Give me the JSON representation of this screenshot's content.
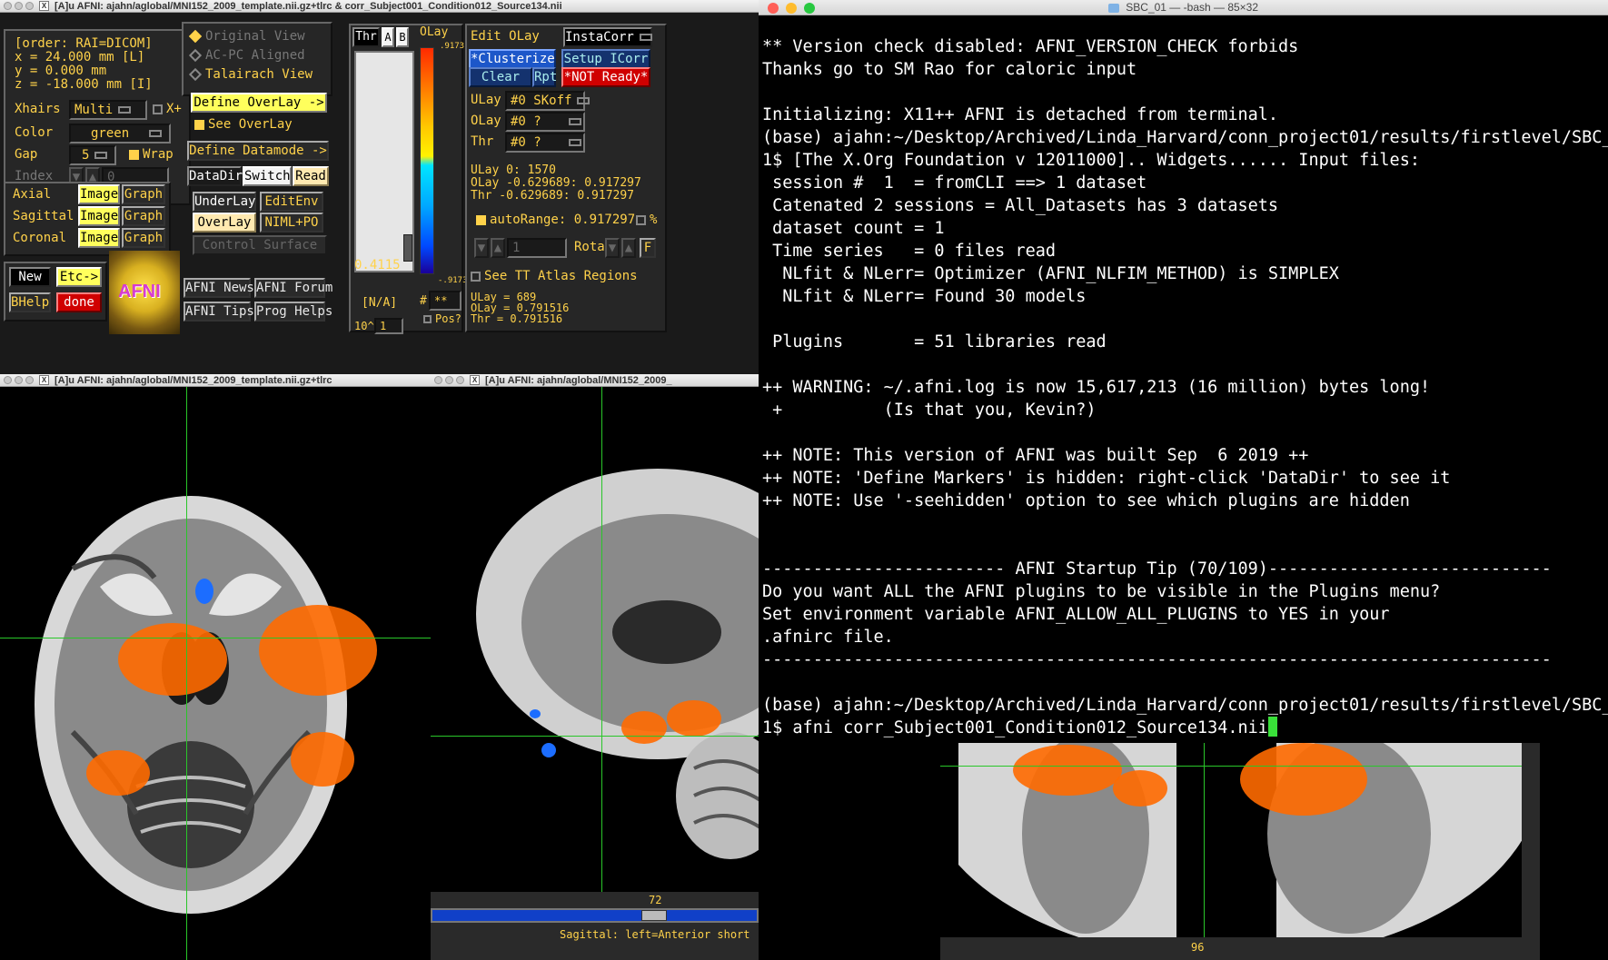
{
  "afni_title": "[A]u AFNI: ajahn/aglobal/MNI152_2009_template.nii.gz+tlrc & corr_Subject001_Condition012_Source134.nii",
  "axial_title": "[A]u AFNI: ajahn/aglobal/MNI152_2009_template.nii.gz+tlrc",
  "sagittal_title": "[A]u AFNI: ajahn/aglobal/MNI152_2009_",
  "coords": {
    "order": "[order: RAI=DICOM]",
    "x": "x =    24.000 mm [L]",
    "y": "y =     0.000 mm",
    "z": "z =   -18.000 mm [I]"
  },
  "xhairs": {
    "label": "Xhairs",
    "value": "Multi",
    "xplus": "X+"
  },
  "color": {
    "label": "Color",
    "value": "green"
  },
  "gap": {
    "label": "Gap",
    "value": "5",
    "wrap": "Wrap"
  },
  "index": {
    "label": "Index",
    "value": "0"
  },
  "views": [
    {
      "label": "Axial",
      "image": "Image",
      "graph": "Graph"
    },
    {
      "label": "Sagittal",
      "image": "Image",
      "graph": "Graph"
    },
    {
      "label": "Coronal",
      "image": "Image",
      "graph": "Graph"
    }
  ],
  "bottom_buttons": {
    "new": "New",
    "etc": "Etc->",
    "bhelp": "BHelp",
    "done": "done",
    "logo": "AFNI"
  },
  "view_modes": {
    "original": "Original View",
    "acpc": "AC-PC Aligned",
    "talairach": "Talairach View"
  },
  "overlay": {
    "define_overlay": "Define OverLay ->",
    "see_overlay": "See OverLay",
    "define_datamode": "Define Datamode ->",
    "datadir": "DataDir",
    "switch": "Switch",
    "read": "Read",
    "underlay": "UnderLay",
    "editenv": "EditEnv",
    "overlay": "OverLay",
    "niml": "NIML+PO",
    "control_surface": "Control Surface"
  },
  "links": {
    "news": "AFNI News",
    "forum": "AFNI Forum",
    "tips": "AFNI Tips",
    "prog": "Prog Helps"
  },
  "threshold": {
    "thr": "Thr",
    "a": "A",
    "b": "B",
    "olay": "OLay",
    "top_val": ".9173",
    "bot_val": "-.9173",
    "value": "0.4115",
    "na": "[N/A]",
    "pow_label": "10^",
    "pow_val": "1",
    "hash": "#",
    "hash_val": "**",
    "pos": "Pos?"
  },
  "edit": {
    "edit_olay": "Edit OLay",
    "instacorr": "InstaCorr",
    "clusterize": "*Clusterize",
    "setup_icorr": "Setup ICorr",
    "clear": "Clear",
    "rpt": "Rpt",
    "not_ready": "*NOT Ready*"
  },
  "lays": {
    "ulay_label": "ULay",
    "ulay_val": "#0 SKoff",
    "olay_label": "OLay",
    "olay_val": "#0 ?",
    "thr_label": "Thr",
    "thr_val": "#0 ?"
  },
  "values": {
    "ulay": "ULay           0:      1570",
    "olay": "OLay  -0.629689: 0.917297",
    "thr": "Thr   -0.629689: 0.917297",
    "autorange": "autoRange: 0.917297",
    "pct": "%",
    "rota_field": "1",
    "rota": "Rota",
    "f": "F",
    "see_tt": "See TT Atlas Regions",
    "bottom_ulay": "ULay = 689",
    "bottom_olay": "OLay = 0.791516",
    "bottom_thr": "Thr  = 0.791516"
  },
  "sagittal": {
    "slider_val": "72",
    "caption": "Sagittal: left=Anterior short"
  },
  "coronal": {
    "slider_val": "96"
  },
  "terminal": {
    "title": "SBC_01 — -bash — 85×32",
    "lines": [
      "** Version check disabled: AFNI_VERSION_CHECK forbids",
      "Thanks go to SM Rao for caloric input",
      "",
      "Initializing: X11++ AFNI is detached from terminal.",
      "(base) ajahn:~/Desktop/Archived/Linda_Harvard/conn_project01/results/firstlevel/SBC_0",
      "1$ [The X.Org Foundation v 12011000].. Widgets...... Input files:",
      " session #  1  = fromCLI ==> 1 dataset",
      " Catenated 2 sessions = All_Datasets has 3 datasets",
      " dataset count = 1",
      " Time series   = 0 files read",
      "  NLfit & NLerr= Optimizer (AFNI_NLFIM_METHOD) is SIMPLEX",
      "  NLfit & NLerr= Found 30 models",
      "",
      " Plugins       = 51 libraries read",
      "",
      "++ WARNING: ~/.afni.log is now 15,617,213 (16 million) bytes long!",
      " +          (Is that you, Kevin?)",
      "",
      "++ NOTE: This version of AFNI was built Sep  6 2019 ++",
      "++ NOTE: 'Define Markers' is hidden: right-click 'DataDir' to see it",
      "++ NOTE: Use '-seehidden' option to see which plugins are hidden",
      "",
      "",
      "------------------------ AFNI Startup Tip (70/109)----------------------------",
      "Do you want ALL the AFNI plugins to be visible in the Plugins menu?",
      "Set environment variable AFNI_ALLOW_ALL_PLUGINS to YES in your",
      ".afnirc file.",
      "------------------------------------------------------------------------------",
      "",
      "(base) ajahn:~/Desktop/Archived/Linda_Harvard/conn_project01/results/firstlevel/SBC_0"
    ],
    "prompt": "1$ afni corr_Subject001_Condition012_Source134.nii"
  }
}
